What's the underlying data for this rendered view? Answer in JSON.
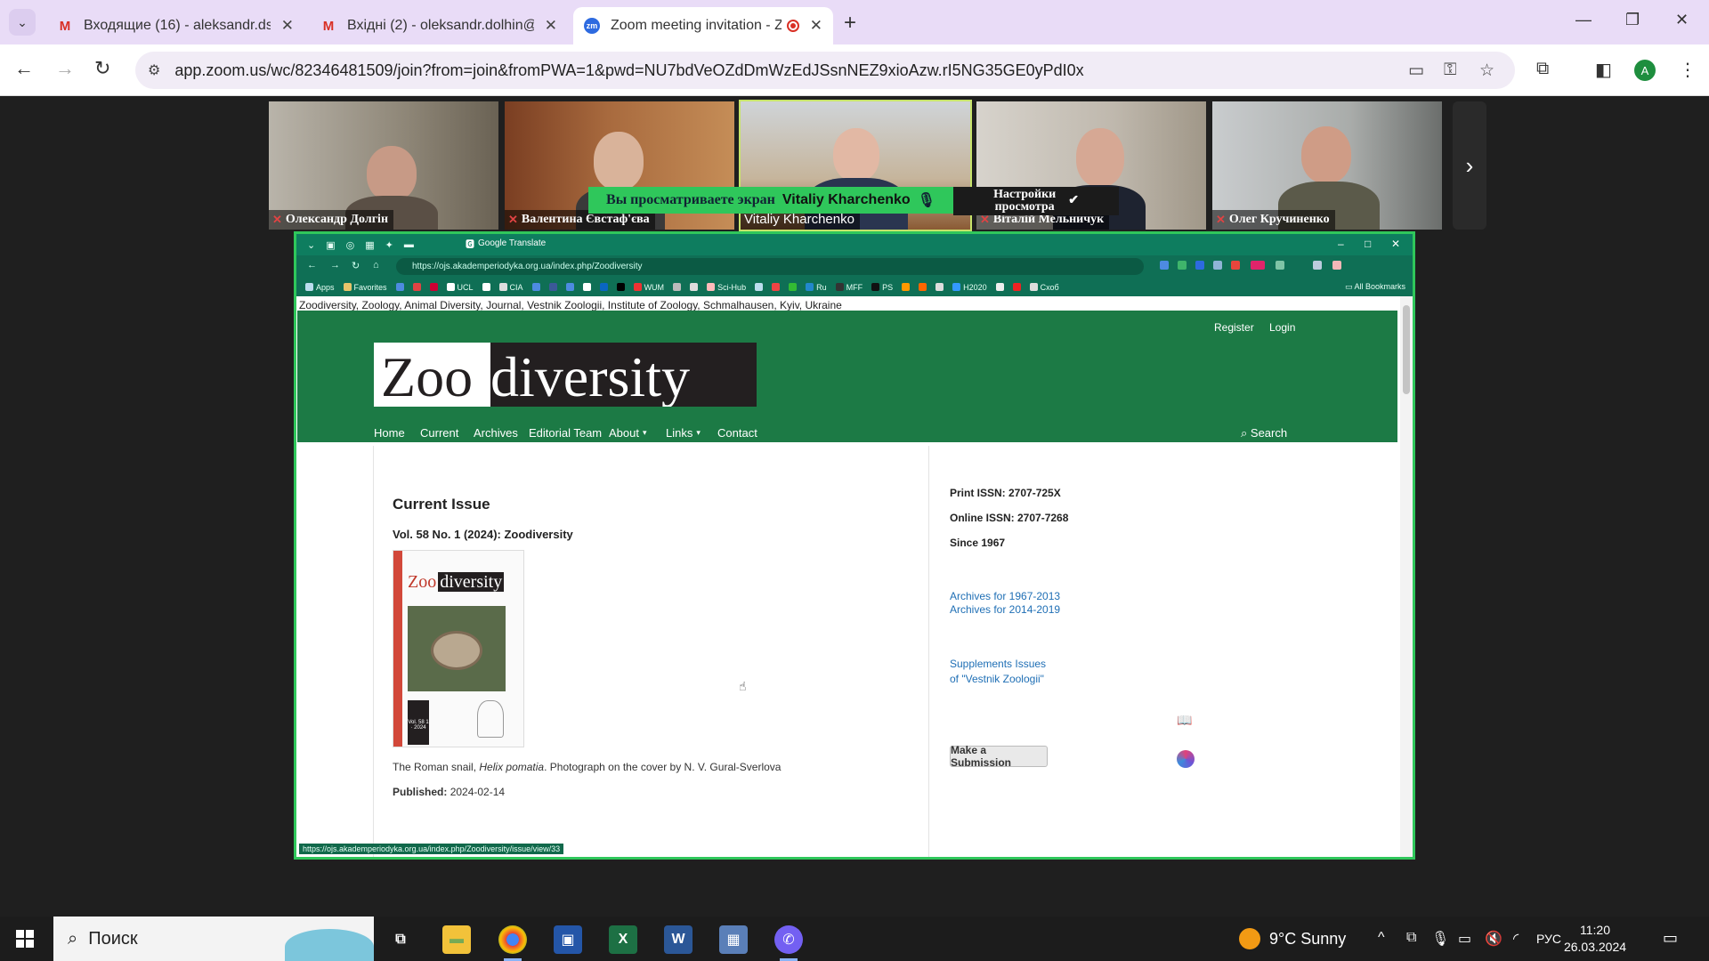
{
  "browser": {
    "tabs": [
      {
        "title": "Входящие (16) - aleksandr.ds8",
        "favicon": "M"
      },
      {
        "title": "Вхідні (2) - oleksandr.dolhin@p",
        "favicon": "M"
      },
      {
        "title": "Zoom meeting invitation - Z",
        "favicon": "zm"
      }
    ],
    "url": "app.zoom.us/wc/82346481509/join?from=join&fromPWA=1&pwd=NU7bdVeOZdDmWzEdJSsnNEZ9xioAzw.rI5NG35GE0yPdI0x",
    "profile_initial": "A"
  },
  "zoom": {
    "participants": [
      {
        "name": "Олександр Долгін",
        "muted": true
      },
      {
        "name": "Валентина Євстаф'єва",
        "muted": true
      },
      {
        "name": "Vitaliy Kharchenko",
        "muted": false
      },
      {
        "name": "Віталій Мельничук",
        "muted": true
      },
      {
        "name": "Олег Кручиненко",
        "muted": true
      }
    ],
    "banner_text": "Вы просматриваете экран",
    "banner_name": "Vitaliy Kharchenko",
    "view_options_line1": "Настройки",
    "view_options_line2": "просмотра"
  },
  "shared": {
    "tab_title": "Google Translate",
    "url": "https://ojs.akademperiodyka.org.ua/index.php/Zoodiversity",
    "bookmarks": [
      "Apps",
      "Favorites",
      "UCL",
      "CIA",
      "WUM",
      "Sci-Hub",
      "Ru",
      "MFF",
      "PS",
      "H2020",
      "Cхоб"
    ],
    "all_bookmarks": "All Bookmarks",
    "page_title": "Zoodiversity, Zoology, Animal Diversity, Journal, Vestnik Zoologii, Institute of Zoology, Schmalhausen, Kyiv, Ukraine",
    "register": "Register",
    "login": "Login",
    "logo_part1": "Zoo",
    "logo_part2": "diversity",
    "nav": {
      "home": "Home",
      "current": "Current",
      "archives": "Archives",
      "editorial": "Editorial Team",
      "about": "About",
      "links": "Links",
      "contact": "Contact"
    },
    "search": "Search",
    "current_issue_heading": "Current Issue",
    "volume": "Vol. 58 No. 1 (2024): Zoodiversity",
    "cover_vol": "Vol. 58 1 · 2024",
    "caption_pre": "The Roman snail, ",
    "caption_species": "Helix pomatia",
    "caption_post": ". Photograph on the cover by N. V. Gural-Sverlova",
    "published_label": "Published:",
    "published_date": "2024-02-14",
    "print_issn": "Print ISSN:    2707-725X",
    "online_issn": "Online ISSN: 2707-7268",
    "since": "Since 1967",
    "archives_1": "Archives for 1967-2013",
    "archives_2": "Archives for 2014-2019",
    "supplements_1": "Supplements Issues",
    "supplements_2": "of \"Vestnik Zoologii\"",
    "submit": "Make a Submission",
    "status_url": "https://ojs.akademperiodyka.org.ua/index.php/Zoodiversity/issue/view/33"
  },
  "taskbar": {
    "search_placeholder": "Поиск",
    "weather": "9°C  Sunny",
    "lang": "РУС",
    "time": "11:20",
    "date": "26.03.2024"
  }
}
